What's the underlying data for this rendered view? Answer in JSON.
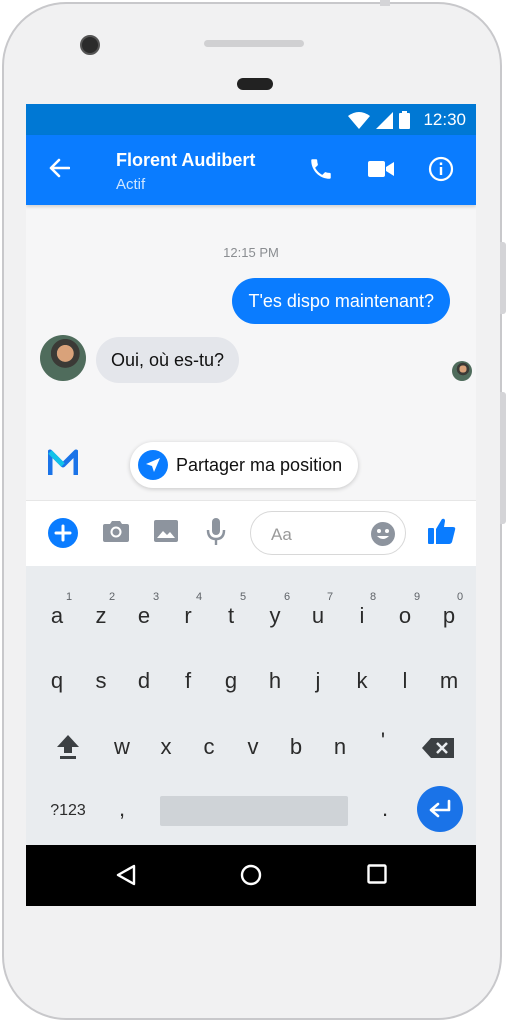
{
  "status_bar": {
    "time": "12:30"
  },
  "header": {
    "contact_name": "Florent Audibert",
    "contact_status": "Actif"
  },
  "chat": {
    "timestamp": "12:15 PM",
    "messages": [
      {
        "direction": "outgoing",
        "text": "T'es dispo maintenant?"
      },
      {
        "direction": "incoming",
        "text": "Oui, où es-tu?"
      }
    ],
    "suggestion_label": "Partager ma position"
  },
  "composer": {
    "placeholder": "Aa"
  },
  "keyboard": {
    "row1": [
      "a",
      "z",
      "e",
      "r",
      "t",
      "y",
      "u",
      "i",
      "o",
      "p"
    ],
    "row1_hints": [
      "1",
      "2",
      "3",
      "4",
      "5",
      "6",
      "7",
      "8",
      "9",
      "0"
    ],
    "row2": [
      "q",
      "s",
      "d",
      "f",
      "g",
      "h",
      "j",
      "k",
      "l",
      "m"
    ],
    "row3": [
      "w",
      "x",
      "c",
      "v",
      "b",
      "n",
      "'"
    ],
    "symbols_key": "?123",
    "comma_key": ",",
    "period_key": "."
  },
  "colors": {
    "status_bar": "#0078d4",
    "app_bar": "#0a7cff",
    "outgoing_bubble": "#0a7cff",
    "incoming_bubble": "#e4e6eb",
    "keyboard_bg": "#e9ecef",
    "enter_key": "#1a73e8"
  },
  "icons": {
    "header": [
      "back-arrow-icon",
      "phone-icon",
      "video-camera-icon",
      "info-icon"
    ],
    "composer": [
      "plus-icon",
      "camera-icon",
      "image-icon",
      "microphone-icon",
      "emoji-icon",
      "thumbs-up-icon"
    ],
    "navbar": [
      "back-triangle-icon",
      "home-circle-icon",
      "recents-square-icon"
    ]
  }
}
